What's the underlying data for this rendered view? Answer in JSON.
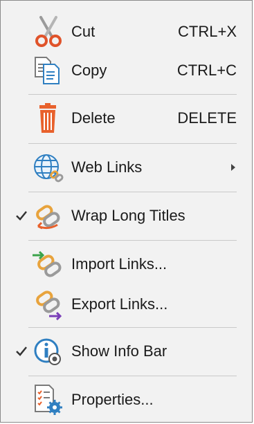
{
  "menu": {
    "items": [
      {
        "label": "Cut",
        "shortcut": "CTRL+X",
        "icon": "scissors-icon"
      },
      {
        "label": "Copy",
        "shortcut": "CTRL+C",
        "icon": "copy-icon"
      },
      {
        "label": "Delete",
        "shortcut": "DELETE",
        "icon": "trash-icon"
      },
      {
        "label": "Web Links",
        "icon": "globe-link-icon",
        "has_submenu": true
      },
      {
        "label": "Wrap Long Titles",
        "icon": "wrap-link-icon",
        "checked": true
      },
      {
        "label": "Import Links...",
        "icon": "import-links-icon"
      },
      {
        "label": "Export Links...",
        "icon": "export-links-icon"
      },
      {
        "label": "Show Info Bar",
        "icon": "info-bar-icon",
        "checked": true
      },
      {
        "label": "Properties...",
        "icon": "properties-icon"
      }
    ]
  },
  "colors": {
    "menu_background": "#f2f2f2",
    "separator": "#c9c9c9",
    "text": "#1a1a1a",
    "accent_orange": "#e8612c",
    "accent_blue": "#2f7fc1"
  }
}
